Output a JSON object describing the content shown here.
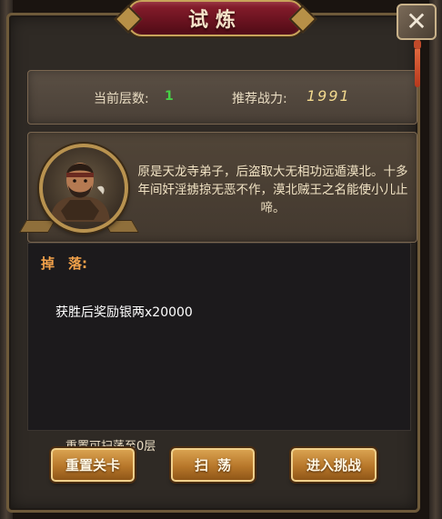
{
  "dialog": {
    "title": "试炼",
    "close_label": "✕"
  },
  "info": {
    "floor_label": "当前层数:",
    "floor_value": "1",
    "power_label": "推荐战力:",
    "power_value": "1991"
  },
  "story": {
    "text": "原是天龙寺弟子，后盗取大无相功远遁漠北。十多年间奸淫掳掠无恶不作，漠北贼王之名能使小儿止啼。",
    "portrait_icon": "bearded-warrior-portrait"
  },
  "drops": {
    "title": "掉　落:",
    "items": [
      "获胜后奖励银两x20000"
    ]
  },
  "reset_hint": "重置可扫荡至0层",
  "buttons": {
    "reset": "重置关卡",
    "sweep": "扫荡",
    "enter": "进入挑战"
  },
  "colors": {
    "title_plate": "#6b1320",
    "floor_value": "#46d046",
    "drops_title": "#f2a14a",
    "button_gold": "#b7772a"
  }
}
